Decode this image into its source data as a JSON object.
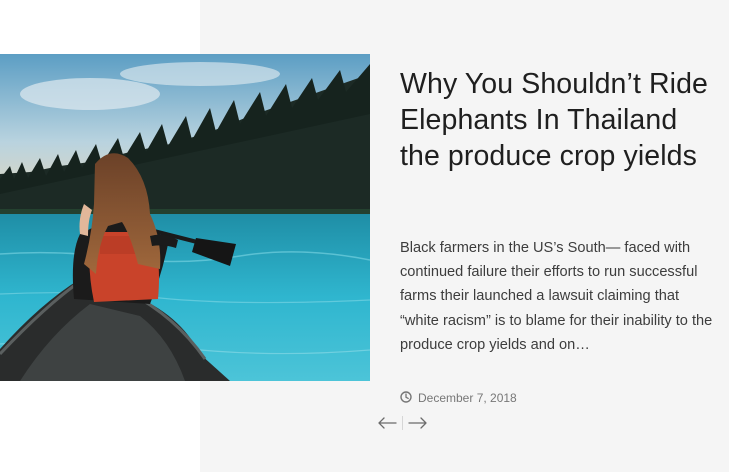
{
  "post": {
    "title": "Why You Shouldn’t Ride Elephants In Thailand the produce crop yields",
    "excerpt": "Black farmers in the US’s South— faced with continued failure their efforts to run successful farms their launched a lawsuit claiming that “white racism” is to blame for their inability to the produce crop yields and on…",
    "date": "December 7, 2018",
    "image_description": "woman in red life vest paddling a canoe on a turquoise lake beside a forested hillside"
  },
  "icons": {
    "date": "clock-icon",
    "prev": "arrow-left-icon",
    "next": "arrow-right-icon"
  },
  "colors": {
    "panel_background": "#f5f5f5",
    "title": "#1f1f1f",
    "text": "#3d3d3d",
    "meta": "#777777"
  }
}
